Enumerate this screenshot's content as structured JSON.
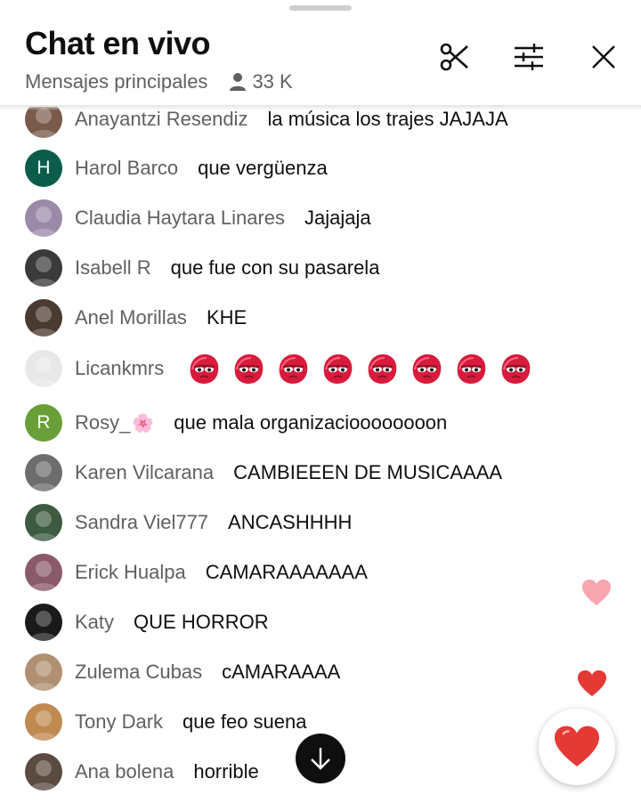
{
  "header": {
    "title": "Chat en vivo",
    "subtitle": "Mensajes principales",
    "viewers": "33 K",
    "icons": [
      "person-icon",
      "scissors-icon",
      "sliders-icon",
      "close-icon"
    ]
  },
  "messages": [
    {
      "author": "Anayantzi Resendiz",
      "text": "la música los trajes JAJAJA",
      "avatar": {
        "type": "photo",
        "color": "#7a5a4a"
      }
    },
    {
      "author": "Harol Barco",
      "text": "que vergüenza",
      "avatar": {
        "type": "letter",
        "letter": "H",
        "color": "#0b5c4a"
      }
    },
    {
      "author": "Claudia Haytara Linares",
      "text": "Jajajaja",
      "avatar": {
        "type": "photo",
        "color": "#9a8aa8"
      }
    },
    {
      "author": "Isabell R",
      "text": "que fue con su pasarela",
      "avatar": {
        "type": "photo",
        "color": "#3a3a3a"
      }
    },
    {
      "author": "Anel Morillas",
      "text": "KHE",
      "avatar": {
        "type": "photo",
        "color": "#4a3a30"
      }
    },
    {
      "author": "Licankmrs",
      "text": "",
      "avatar": {
        "type": "photo",
        "color": "#e8e8e8"
      },
      "emoji_count": 8,
      "emoji_name": "red-blob-emoji"
    },
    {
      "author": "Rosy_",
      "author_suffix": "🌸",
      "text": "que mala organizacioooooooon",
      "avatar": {
        "type": "letter",
        "letter": "R",
        "color": "#689f38"
      }
    },
    {
      "author": "Karen Vilcarana",
      "text": "CAMBIEEEN DE MUSICAAAA",
      "avatar": {
        "type": "photo",
        "color": "#6d6d6d"
      }
    },
    {
      "author": "Sandra Viel777",
      "text": "ANCASHHHH",
      "avatar": {
        "type": "photo",
        "color": "#3e5a40"
      }
    },
    {
      "author": "Erick Hualpa",
      "text": "CAMARAAAAAAA",
      "avatar": {
        "type": "photo",
        "color": "#8a5a6a"
      }
    },
    {
      "author": "Katy",
      "text": "QUE HORROR",
      "avatar": {
        "type": "photo",
        "color": "#1a1a1a"
      }
    },
    {
      "author": "Zulema Cubas",
      "text": "cAMARAAAA",
      "avatar": {
        "type": "photo",
        "color": "#b09070"
      }
    },
    {
      "author": "Tony Dark",
      "text": "que feo suena",
      "avatar": {
        "type": "photo",
        "color": "#c08a50"
      }
    },
    {
      "author": "Ana bolena",
      "text": "horrible",
      "avatar": {
        "type": "photo",
        "color": "#5a4a40"
      }
    }
  ],
  "controls": {
    "scroll_down_icon": "arrow-down-icon",
    "reaction_icon": "heart-icon",
    "heart_color": "#e53935",
    "floating_pink_heart_color": "#f7a6b0"
  }
}
